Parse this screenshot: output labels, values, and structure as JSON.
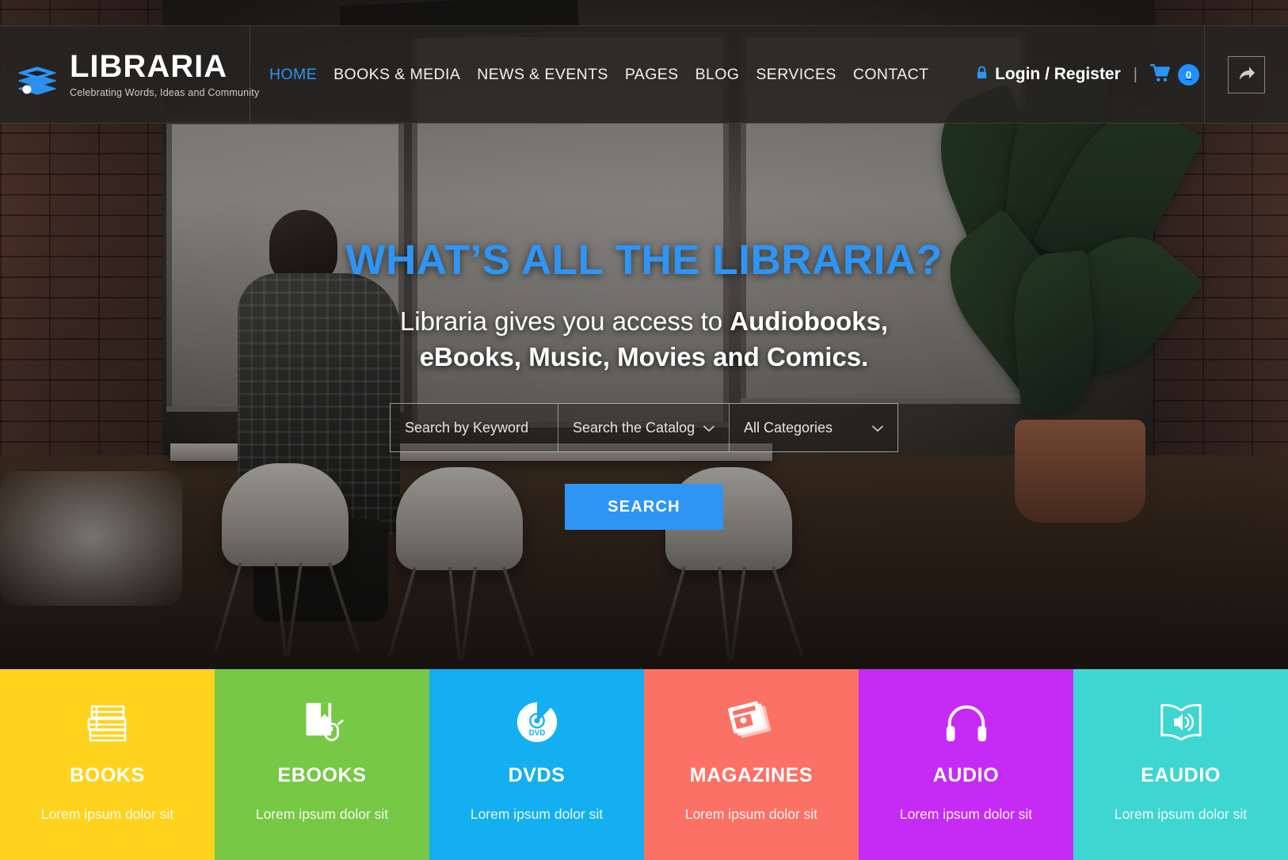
{
  "brand": {
    "name": "LIBRARIA",
    "tagline": "Celebrating Words, Ideas and Community",
    "logo_icon": "stacked-books-icon",
    "accent_color": "#2e95f5"
  },
  "nav": {
    "items": [
      {
        "label": "HOME",
        "active": true
      },
      {
        "label": "BOOKS & MEDIA",
        "active": false
      },
      {
        "label": "NEWS & EVENTS",
        "active": false
      },
      {
        "label": "PAGES",
        "active": false
      },
      {
        "label": "BLOG",
        "active": false
      },
      {
        "label": "SERVICES",
        "active": false
      },
      {
        "label": "CONTACT",
        "active": false
      }
    ]
  },
  "header_right": {
    "lock_icon": "lock-icon",
    "login_label": "Login / Register",
    "separator": "|",
    "cart_icon": "shopping-cart-icon",
    "cart_count": "0",
    "share_icon": "share-arrow-icon"
  },
  "hero": {
    "title": "WHAT’S ALL THE LIBRARIA?",
    "subtitle_lead": "Libraria gives you access to ",
    "subtitle_bold": "Audiobooks, eBooks, Music, Movies and Comics.",
    "search": {
      "keyword_placeholder": "Search by Keyword",
      "catalog_value": "Search the Catalog",
      "categories_value": "All Categories",
      "chevron_icon": "chevron-down-icon",
      "button_label": "SEARCH"
    }
  },
  "categories": [
    {
      "title": "BOOKS",
      "desc": "Lorem ipsum dolor sit",
      "color": "#FFD21E",
      "icon": "books-stack-icon"
    },
    {
      "title": "EBOOKS",
      "desc": "Lorem ipsum dolor sit",
      "color": "#76C845",
      "icon": "ebook-mouse-icon"
    },
    {
      "title": "DVDS",
      "desc": "Lorem ipsum dolor sit",
      "color": "#13AFF0",
      "icon": "dvd-disc-icon"
    },
    {
      "title": "MAGAZINES",
      "desc": "Lorem ipsum dolor sit",
      "color": "#FC7166",
      "icon": "magazines-icon"
    },
    {
      "title": "AUDIO",
      "desc": "Lorem ipsum dolor sit",
      "color": "#C52BF5",
      "icon": "headphones-icon"
    },
    {
      "title": "EAUDIO",
      "desc": "Lorem ipsum dolor sit",
      "color": "#3ED6D0",
      "icon": "audiobook-speaker-icon"
    }
  ]
}
